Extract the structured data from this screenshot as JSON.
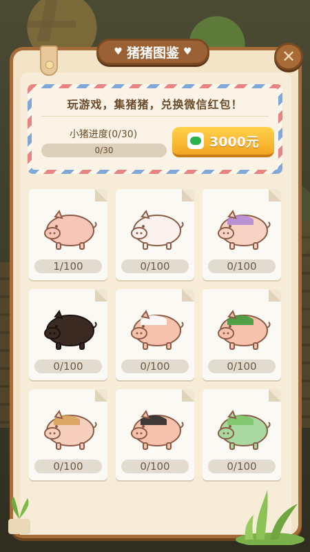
{
  "header": {
    "title": "猪猪图鉴",
    "close_icon": "close-icon"
  },
  "promo": {
    "slogan": "玩游戏，集猪猪，兑换微信红包！",
    "progress_label": "小猪进度(0/30)",
    "progress_text": "0/30",
    "progress_fraction": 0,
    "reward_label": "3000元"
  },
  "pigs": [
    {
      "count": "1/100",
      "variant": "pink-pig"
    },
    {
      "count": "0/100",
      "variant": "white-pig"
    },
    {
      "count": "0/100",
      "variant": "baby-pig-pacifier"
    },
    {
      "count": "0/100",
      "variant": "black-pig"
    },
    {
      "count": "0/100",
      "variant": "towel-pig"
    },
    {
      "count": "0/100",
      "variant": "watermelon-pig"
    },
    {
      "count": "0/100",
      "variant": "toast-pig"
    },
    {
      "count": "0/100",
      "variant": "cool-sunglasses-pig"
    },
    {
      "count": "0/100",
      "variant": "green-gourd-pig"
    }
  ],
  "colors": {
    "accent": "#f4a623",
    "frame": "#a56c3a",
    "panel": "#f3e3c7"
  }
}
